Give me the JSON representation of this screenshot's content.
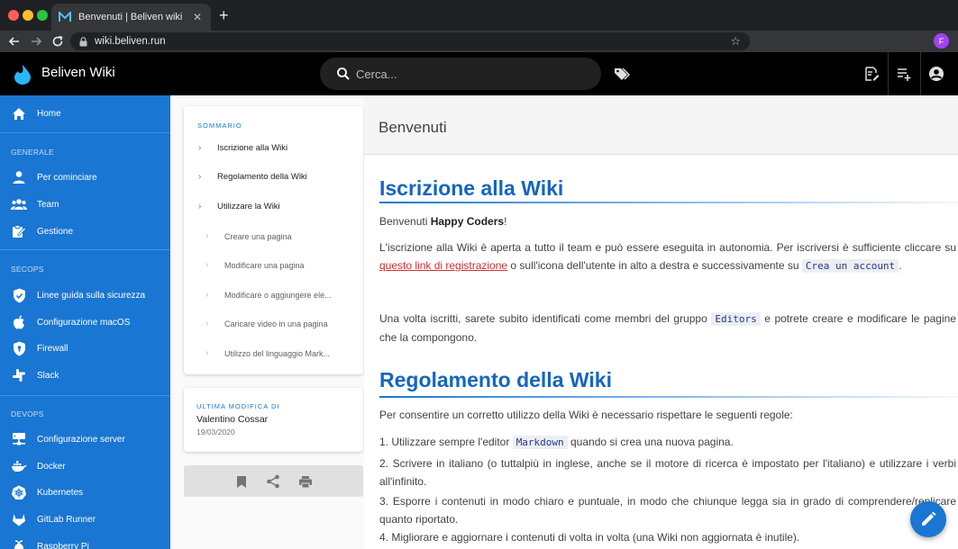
{
  "browser": {
    "tab_title": "Benvenuti | Beliven wiki",
    "url": "wiki.beliven.run",
    "profile_initial": "F"
  },
  "header": {
    "site_title": "Beliven Wiki",
    "search_placeholder": "Cerca..."
  },
  "sidebar": {
    "home": "Home",
    "sections": [
      {
        "title": "GENERALE",
        "items": [
          "Per cominciare",
          "Team",
          "Gestione"
        ]
      },
      {
        "title": "SECOPS",
        "items": [
          "Linee guida sulla sicurezza",
          "Configurazione macOS",
          "Firewall",
          "Slack"
        ]
      },
      {
        "title": "DEVOPS",
        "items": [
          "Configurazione server",
          "Docker",
          "Kubernetes",
          "GitLab Runner",
          "Raspberry Pi"
        ]
      }
    ]
  },
  "toc": {
    "heading": "SOMMARIO",
    "items": [
      "Iscrizione alla Wiki",
      "Regolamento della Wiki",
      "Utilizzare la Wiki",
      "Creare una pagina",
      "Modificare una pagina",
      "Modificare o aggiungere ele...",
      "Caricare video in una pagina",
      "Utilizzo del linguaggio Mark..."
    ]
  },
  "last_modified": {
    "heading": "ULTIMA MODIFICA DI",
    "author": "Valentino Cossar",
    "date": "19/03/2020"
  },
  "page": {
    "title": "Benvenuti",
    "section1_title": "Iscrizione alla Wiki",
    "welcome_pre": "Benvenuti ",
    "welcome_bold": "Happy Coders",
    "welcome_post": "!",
    "p1_a": "L'iscrizione alla Wiki è aperta a tutto il team e può essere eseguita in autonomia. Per iscriversi è sufficiente cliccare su ",
    "p1_link": "questo link di registrazione",
    "p1_b": " o sull'icona dell'utente in alto a destra e successivamente su ",
    "p1_code": "Crea un account",
    "p1_c": ".",
    "p2_a": "Una volta iscritti, sarete subito identificati come membri del gruppo ",
    "p2_code": "Editors",
    "p2_b": " e potrete creare e modificare le pagine che la compongono.",
    "section2_title": "Regolamento della Wiki",
    "p3": "Per consentire un corretto utilizzo della Wiki è necessario rispettare le seguenti regole:",
    "rule1_a": "1. Utilizzare sempre l'editor ",
    "rule1_code": "Markdown",
    "rule1_b": " quando si crea una nuova pagina.",
    "rule2": "2. Scrivere in italiano (o tuttalpiù in inglese, anche se il motore di ricerca è impostato per l'italiano) e utilizzare i verbi all'infinito.",
    "rule3": "3. Esporre i contenuti in modo chiaro e puntuale, in modo che chiunque legga sia in grado di comprendere/replicare quanto riportato.",
    "rule4": "4. Migliorare e aggiornare i contenuti di volta in volta (una Wiki non aggiornata è inutile)."
  },
  "colors": {
    "sidebar": "#1976d2",
    "heading": "#1565c0",
    "link": "#d32f2f"
  }
}
